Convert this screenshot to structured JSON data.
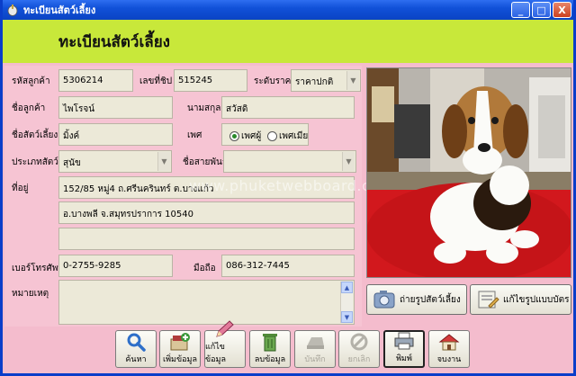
{
  "window": {
    "title": "ทะเบียนสัตว์เลี้ยง",
    "minimize": "_",
    "maximize": "□",
    "close": "X"
  },
  "header": {
    "title": "ทะเบียนสัตว์เลี้ยง"
  },
  "form": {
    "customer_code": {
      "label": "รหัสลูกค้า",
      "value": "5306214"
    },
    "chip_no": {
      "label": "เลขที่ชิป",
      "value": "515245"
    },
    "price_level": {
      "label": "ระดับราคา",
      "value": "ราคาปกติ"
    },
    "customer_name": {
      "label": "ชื่อลูกค้า",
      "value": "ไพโรจน์"
    },
    "surname": {
      "label": "นามสกุล",
      "value": "สวัสดิ"
    },
    "pet_name": {
      "label": "ชื่อสัตว์เลี้ยง",
      "value": "มิ้งค์"
    },
    "sex": {
      "label": "เพศ",
      "male": "เพศผู้",
      "female": "เพศเมีย",
      "selected": "male"
    },
    "pet_type": {
      "label": "ประเภทสัตว์",
      "value": "สุนัข"
    },
    "breed": {
      "label": "ชื่อสายพันธุ์",
      "value": ""
    },
    "address": {
      "label": "ที่อยู่",
      "line1": "152/85 หมู่4 ถ.ศรีนครินทร์ ต.บางแก้ว",
      "line2": "อ.บางพลี จ.สมุทรปราการ 10540",
      "line3": ""
    },
    "phone": {
      "label": "เบอร์โทรศัพท์",
      "value": "0-2755-9285"
    },
    "mobile": {
      "label": "มือถือ",
      "value": "086-312-7445"
    },
    "note": {
      "label": "หมายเหตุ",
      "value": ""
    }
  },
  "watermark": "www.phuketwebboard.com",
  "side_buttons": {
    "take_photo": "ถ่ายรูปสัตว์เลี้ยง",
    "edit_card": "แก้ไขรูปแบบบัตร"
  },
  "toolbar": {
    "search": "ค้นหา",
    "add": "เพิ่มข้อมูล",
    "edit": "แก้ไขข้อมูล",
    "delete": "ลบข้อมูล",
    "save": "บันทึก",
    "cancel": "ยกเลิก",
    "print": "พิมพ์",
    "exit": "จบงาน"
  },
  "colors": {
    "window_bg": "#f4bccd",
    "header_band": "#c8e83a",
    "titlebar": "#0a44c4",
    "field_bg": "#ece9d8"
  }
}
